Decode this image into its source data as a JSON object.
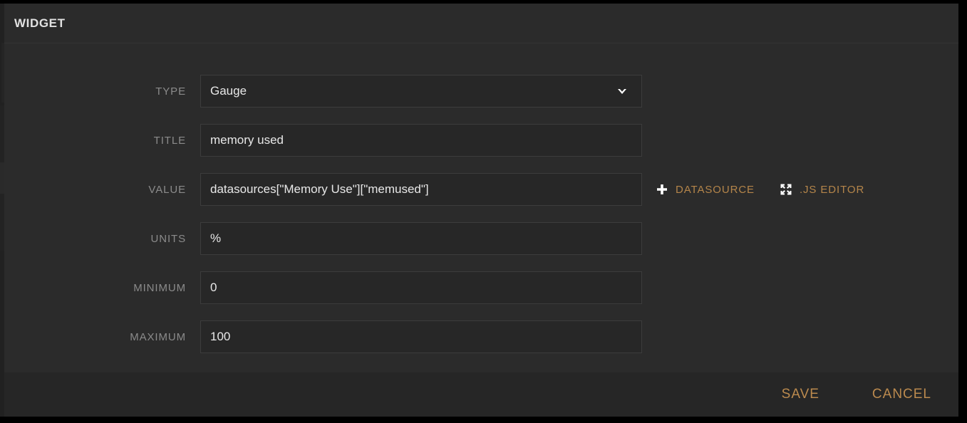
{
  "window": {
    "title": "WIDGET"
  },
  "form": {
    "rows": [
      {
        "label": "TYPE",
        "control": "select",
        "value": "Gauge",
        "name": "type"
      },
      {
        "label": "TITLE",
        "control": "text",
        "value": "memory used",
        "placeholder": "",
        "name": "title"
      },
      {
        "label": "VALUE",
        "control": "text",
        "value": "datasources[\"Memory Use\"][\"memused\"]",
        "placeholder": "",
        "name": "value"
      },
      {
        "label": "UNITS",
        "control": "text",
        "value": "%",
        "placeholder": "",
        "name": "units"
      },
      {
        "label": "MINIMUM",
        "control": "text",
        "value": "0",
        "placeholder": "",
        "name": "minimum"
      },
      {
        "label": "MAXIMUM",
        "control": "text",
        "value": "100",
        "placeholder": "",
        "name": "maximum"
      }
    ]
  },
  "value_actions": {
    "datasource": {
      "label": "DATASOURCE",
      "icon": "plus-icon"
    },
    "js_editor": {
      "label": ".JS EDITOR",
      "icon": "expand-arrows-icon"
    }
  },
  "footer": {
    "save_label": "SAVE",
    "cancel_label": "CANCEL"
  },
  "colors": {
    "accent": "#b4854a",
    "window_background": "#2b2b2b",
    "input_background": "#272727",
    "input_border": "#3c3c3c",
    "label_text": "#8b8b8b",
    "input_text": "#e8e8e8",
    "footer_background": "#262626"
  }
}
